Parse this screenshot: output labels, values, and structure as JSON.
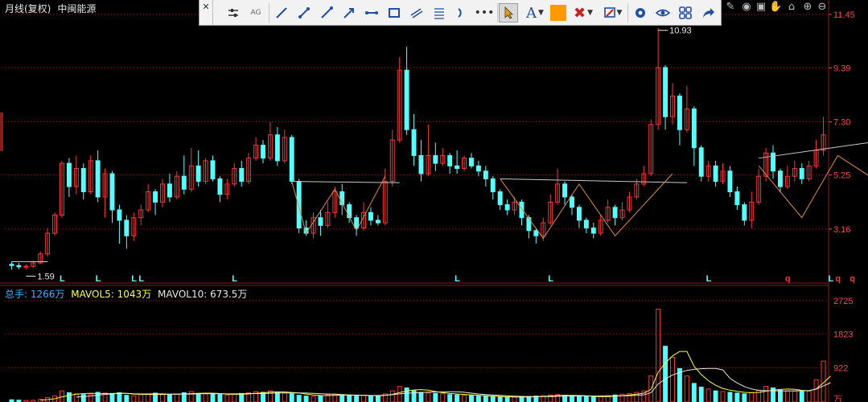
{
  "header": {
    "period_label": "月线(复权)",
    "stock_name": "中闽能源"
  },
  "volume_header": {
    "total_label": "总手: 1266万",
    "ma5_label": "MAVOL5: 1043万",
    "ma10_label": "MAVOL10: 673.5万",
    "total_color": "#33b2ff",
    "ma5_color": "#ffff33",
    "ma10_color": "#e6e6e6"
  },
  "colors": {
    "up": "#ff3333",
    "down": "#54ffff",
    "grid": "#8b1a1a",
    "axis_text": "#ff4444",
    "toolbar_blue": "#1f4fa8",
    "fill_orange": "#ff9900",
    "trendline": "#c8c8c8",
    "pattern_line": "#e08a3a"
  },
  "toolbar": {
    "close_icon": "close-icon",
    "icons": [
      "settings-icon",
      "ag-icon",
      "line-icon",
      "segment-icon",
      "ray-icon",
      "arrow-line-icon",
      "horizontal-line-icon",
      "rectangle-icon",
      "parallel-line-icon",
      "fib-icon",
      "arc-icon",
      "more-icon",
      "pointer-icon",
      "text-icon",
      "color-swatch-icon",
      "delete-icon",
      "pen-icon",
      "gear-icon",
      "eye-icon",
      "grid-icon",
      "share-icon"
    ],
    "text_tool_label": "A"
  },
  "right_icons": [
    "brush-icon",
    "eye-icon",
    "camera-icon",
    "hand-icon",
    "lock-icon",
    "zoom-in-icon",
    "zoom-out-icon"
  ],
  "chart_data": {
    "type": "candlestick",
    "price_axis_ticks": [
      "11.45",
      "9.39",
      "7.30",
      "5.25",
      "3.16"
    ],
    "price_axis_values": [
      11.45,
      9.39,
      7.3,
      5.25,
      3.16
    ],
    "volume_axis_ticks": [
      "2725",
      "1823",
      "922",
      "万"
    ],
    "volume_axis_values": [
      2725,
      1823,
      922
    ],
    "annotations": {
      "low": "1.59",
      "high": "10.93"
    },
    "markers": [
      {
        "text": "L",
        "index": 7
      },
      {
        "text": "L",
        "index": 12
      },
      {
        "text": "L",
        "index": 17
      },
      {
        "text": "L",
        "index": 18
      },
      {
        "text": "L",
        "index": 31
      },
      {
        "text": "L",
        "index": 62
      },
      {
        "text": "L",
        "index": 75
      },
      {
        "text": "L",
        "index": 97
      },
      {
        "text": "q",
        "index": 108
      },
      {
        "text": "L",
        "index": 114
      },
      {
        "text": "q",
        "index": 115
      },
      {
        "text": "q",
        "index": 117
      },
      {
        "text": "q",
        "index": 122
      }
    ],
    "candles": [
      [
        1.8,
        1.75,
        1.9,
        1.6
      ],
      [
        1.75,
        1.7,
        1.85,
        1.6
      ],
      [
        1.7,
        1.72,
        1.8,
        1.59
      ],
      [
        1.72,
        1.85,
        1.95,
        1.65
      ],
      [
        1.85,
        2.2,
        2.3,
        1.8
      ],
      [
        2.2,
        3.0,
        3.2,
        2.1
      ],
      [
        3.0,
        3.7,
        3.8,
        2.9
      ],
      [
        3.7,
        5.7,
        5.8,
        3.6
      ],
      [
        5.7,
        4.8,
        5.9,
        4.4
      ],
      [
        4.8,
        5.5,
        6.0,
        4.5
      ],
      [
        5.5,
        4.6,
        5.7,
        4.3
      ],
      [
        4.6,
        5.8,
        6.0,
        4.5
      ],
      [
        5.8,
        4.4,
        6.2,
        4.2
      ],
      [
        4.4,
        5.3,
        5.5,
        3.6
      ],
      [
        5.3,
        3.9,
        5.4,
        3.4
      ],
      [
        3.9,
        3.5,
        4.1,
        2.6
      ],
      [
        3.5,
        2.9,
        3.7,
        2.4
      ],
      [
        2.9,
        3.6,
        3.8,
        2.7
      ],
      [
        3.6,
        3.9,
        4.1,
        3.3
      ],
      [
        3.9,
        4.6,
        4.9,
        3.8
      ],
      [
        4.6,
        4.2,
        4.7,
        3.7
      ],
      [
        4.2,
        4.9,
        5.1,
        4.0
      ],
      [
        4.9,
        4.4,
        5.3,
        4.2
      ],
      [
        4.4,
        5.2,
        5.4,
        4.3
      ],
      [
        5.2,
        4.7,
        6.0,
        4.5
      ],
      [
        4.7,
        5.6,
        6.3,
        4.6
      ],
      [
        5.6,
        5.0,
        6.2,
        4.8
      ],
      [
        5.0,
        5.8,
        5.9,
        4.9
      ],
      [
        5.8,
        5.1,
        6.0,
        5.0
      ],
      [
        5.1,
        4.5,
        5.2,
        4.2
      ],
      [
        4.5,
        4.9,
        5.1,
        4.3
      ],
      [
        4.9,
        5.5,
        5.7,
        4.8
      ],
      [
        5.5,
        5.0,
        5.8,
        4.8
      ],
      [
        5.0,
        5.9,
        6.1,
        4.9
      ],
      [
        5.9,
        6.4,
        6.7,
        5.8
      ],
      [
        6.4,
        5.9,
        6.6,
        5.7
      ],
      [
        5.9,
        6.8,
        7.3,
        5.8
      ],
      [
        6.8,
        5.8,
        7.1,
        5.6
      ],
      [
        5.8,
        6.7,
        7.0,
        5.7
      ],
      [
        6.7,
        5.0,
        6.8,
        4.9
      ],
      [
        5.0,
        3.2,
        5.1,
        3.0
      ],
      [
        3.2,
        3.0,
        3.5,
        2.9
      ],
      [
        3.0,
        3.6,
        3.8,
        2.8
      ],
      [
        3.6,
        3.3,
        3.9,
        2.9
      ],
      [
        3.3,
        3.8,
        4.2,
        3.2
      ],
      [
        3.8,
        4.6,
        4.8,
        3.6
      ],
      [
        4.6,
        4.1,
        4.9,
        3.7
      ],
      [
        4.1,
        3.6,
        4.2,
        3.4
      ],
      [
        3.6,
        3.2,
        3.7,
        2.9
      ],
      [
        3.2,
        3.8,
        4.2,
        3.1
      ],
      [
        3.8,
        3.5,
        4.0,
        3.3
      ],
      [
        3.5,
        3.4,
        3.7,
        3.3
      ],
      [
        3.4,
        5.0,
        5.5,
        3.3
      ],
      [
        5.0,
        6.6,
        7.0,
        4.8
      ],
      [
        6.6,
        9.3,
        9.8,
        6.5
      ],
      [
        9.3,
        7.0,
        10.2,
        6.8
      ],
      [
        7.0,
        6.0,
        7.6,
        5.6
      ],
      [
        6.0,
        5.3,
        6.6,
        5.0
      ],
      [
        5.3,
        6.0,
        7.2,
        5.2
      ],
      [
        6.0,
        5.7,
        6.5,
        5.4
      ],
      [
        5.7,
        6.0,
        6.3,
        5.6
      ],
      [
        6.0,
        5.6,
        6.1,
        5.3
      ],
      [
        5.6,
        5.5,
        6.2,
        5.3
      ],
      [
        5.5,
        5.9,
        6.0,
        5.4
      ],
      [
        5.9,
        5.6,
        6.1,
        5.5
      ],
      [
        5.6,
        5.4,
        5.8,
        5.2
      ],
      [
        5.4,
        5.1,
        5.6,
        4.8
      ],
      [
        5.1,
        4.6,
        5.2,
        4.3
      ],
      [
        4.6,
        4.1,
        4.7,
        3.9
      ],
      [
        4.1,
        3.9,
        4.3,
        3.7
      ],
      [
        3.9,
        4.2,
        4.4,
        3.7
      ],
      [
        4.2,
        3.6,
        4.3,
        3.3
      ],
      [
        3.6,
        3.1,
        3.7,
        2.8
      ],
      [
        3.1,
        2.9,
        3.2,
        2.6
      ],
      [
        2.9,
        3.4,
        3.6,
        2.7
      ],
      [
        3.4,
        4.2,
        4.5,
        3.3
      ],
      [
        4.2,
        4.9,
        5.5,
        4.1
      ],
      [
        4.9,
        4.4,
        5.0,
        4.1
      ],
      [
        4.4,
        4.0,
        4.5,
        3.7
      ],
      [
        4.0,
        3.5,
        4.1,
        3.2
      ],
      [
        3.5,
        3.2,
        3.6,
        3.0
      ],
      [
        3.2,
        3.0,
        3.4,
        2.8
      ],
      [
        3.0,
        3.5,
        3.7,
        2.9
      ],
      [
        3.5,
        4.0,
        4.3,
        3.4
      ],
      [
        4.0,
        3.6,
        4.1,
        3.3
      ],
      [
        3.6,
        3.9,
        4.2,
        3.5
      ],
      [
        3.9,
        4.4,
        4.6,
        3.8
      ],
      [
        4.4,
        4.9,
        5.1,
        4.3
      ],
      [
        4.9,
        5.3,
        5.6,
        4.8
      ],
      [
        5.3,
        7.2,
        7.4,
        5.2
      ],
      [
        7.2,
        9.4,
        10.93,
        7.0
      ],
      [
        9.4,
        7.5,
        9.5,
        7.0
      ],
      [
        7.5,
        8.3,
        8.8,
        7.2
      ],
      [
        8.3,
        7.0,
        8.4,
        6.4
      ],
      [
        7.0,
        7.8,
        8.7,
        6.9
      ],
      [
        7.8,
        6.3,
        7.9,
        5.6
      ],
      [
        6.3,
        5.2,
        6.4,
        5.0
      ],
      [
        5.2,
        5.6,
        5.8,
        5.0
      ],
      [
        5.6,
        5.0,
        5.8,
        4.8
      ],
      [
        5.0,
        5.4,
        5.7,
        4.9
      ],
      [
        5.4,
        4.6,
        5.6,
        4.4
      ],
      [
        4.6,
        4.1,
        4.8,
        3.9
      ],
      [
        4.1,
        3.5,
        4.2,
        3.3
      ],
      [
        3.5,
        4.2,
        4.6,
        3.2
      ],
      [
        4.2,
        5.2,
        5.5,
        4.1
      ],
      [
        5.2,
        6.1,
        6.3,
        5.0
      ],
      [
        6.1,
        5.4,
        6.4,
        5.1
      ],
      [
        5.4,
        4.8,
        5.5,
        4.6
      ],
      [
        4.8,
        5.2,
        5.6,
        4.7
      ],
      [
        5.2,
        5.5,
        5.8,
        5.0
      ],
      [
        5.5,
        5.1,
        5.7,
        4.9
      ],
      [
        5.1,
        5.6,
        5.8,
        5.0
      ],
      [
        5.6,
        6.2,
        6.6,
        5.5
      ],
      [
        6.2,
        6.8,
        7.5,
        6.0
      ]
    ],
    "volumes": [
      60,
      50,
      40,
      45,
      70,
      120,
      160,
      300,
      250,
      220,
      200,
      210,
      260,
      240,
      230,
      250,
      180,
      170,
      200,
      220,
      240,
      200,
      190,
      210,
      250,
      280,
      230,
      220,
      210,
      200,
      190,
      210,
      230,
      250,
      280,
      260,
      300,
      270,
      240,
      220,
      180,
      160,
      150,
      170,
      200,
      210,
      190,
      170,
      160,
      180,
      170,
      160,
      220,
      300,
      420,
      380,
      300,
      260,
      240,
      230,
      220,
      200,
      190,
      180,
      170,
      160,
      150,
      140,
      130,
      120,
      130,
      140,
      150,
      160,
      170,
      190,
      200,
      180,
      160,
      150,
      140,
      130,
      150,
      170,
      190,
      210,
      230,
      260,
      300,
      700,
      2500,
      1500,
      1200,
      900,
      700,
      500,
      400,
      350,
      300,
      280,
      260,
      240,
      220,
      250,
      320,
      420,
      380,
      320,
      300,
      290,
      280,
      300,
      600,
      1100,
      1200
    ]
  }
}
